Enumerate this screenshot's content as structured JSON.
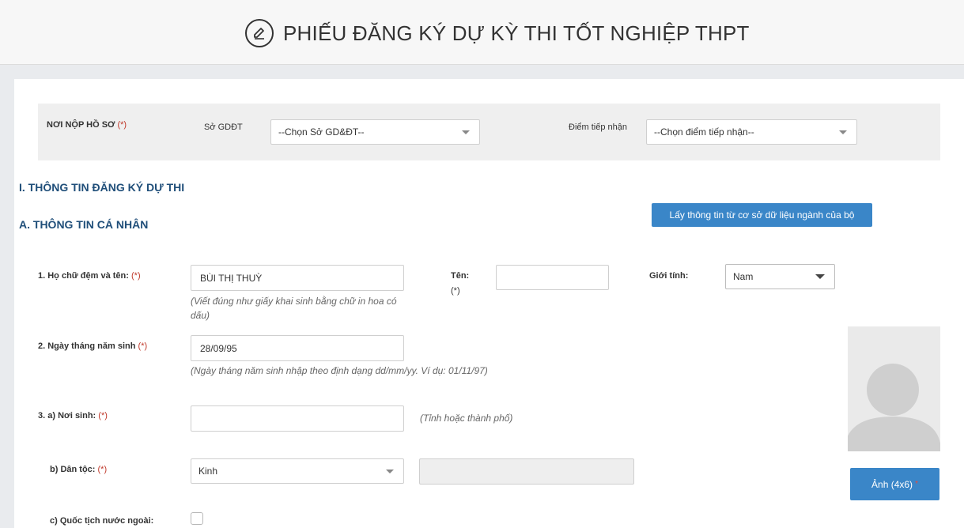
{
  "header": {
    "title": "PHIẾU ĐĂNG KÝ DỰ KỲ THI TỐT NGHIỆP THPT",
    "icon": "edit-circle-icon"
  },
  "submission": {
    "label": "NƠI NỘP HỒ SƠ",
    "required_mark": "(*)",
    "department_label": "Sở GDĐT",
    "department_value": "--Chọn Sở GD&ĐT--",
    "reception_label": "Điểm tiếp nhận",
    "reception_value": "--Chọn điểm tiếp nhận--"
  },
  "section_one": {
    "title": "I. THÔNG TIN ĐĂNG KÝ DỰ THI"
  },
  "section_a": {
    "title": "A. THÔNG TIN CÁ NHÂN",
    "fetch_button": "Lấy thông tin từ cơ sở dữ liệu ngành của bộ"
  },
  "fields": {
    "full_name": {
      "label": "1. Họ chữ đệm và tên:",
      "required_mark": "(*)",
      "value": "BÙI THỊ THUỲ",
      "hint": "(Viết đúng như giấy khai sinh bằng chữ in hoa có dấu)"
    },
    "first_name": {
      "label": "Tên:",
      "required_mark": "(*)",
      "value": ""
    },
    "gender": {
      "label": "Giới tính:",
      "value": "Nam"
    },
    "dob": {
      "label": "2. Ngày tháng năm sinh",
      "required_mark": "(*)",
      "value": "28/09/95",
      "hint": "(Ngày tháng năm sinh nhập theo định dạng dd/mm/yy. Ví dụ: 01/11/97)"
    },
    "birthplace": {
      "label": "3. a) Nơi sinh:",
      "required_mark": "(*)",
      "value": "",
      "hint": "(Tỉnh hoặc thành phố)"
    },
    "ethnicity": {
      "label": "b) Dân tộc:",
      "required_mark": "(*)",
      "value": "Kinh",
      "other_value": ""
    },
    "foreign_nationality": {
      "label": "c) Quốc tịch nước ngoài:",
      "checked": false
    }
  },
  "photo": {
    "button": "Ảnh (4x6)",
    "required_mark": "*",
    "icon": "avatar-placeholder-icon"
  },
  "colors": {
    "accent": "#3a86c8",
    "heading": "#1f4e79",
    "required": "#c0392b"
  }
}
